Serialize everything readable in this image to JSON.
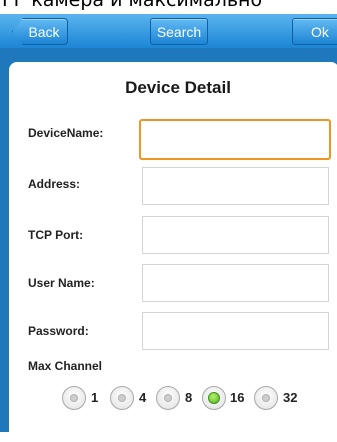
{
  "top_strip_text": "ГГ камера и максимально",
  "navbar": {
    "back_label": "Back",
    "search_label": "Search",
    "ok_label": "Ok"
  },
  "dialog": {
    "title": "Device Detail",
    "fields": [
      {
        "label": "DeviceName:",
        "value": "",
        "focused": true
      },
      {
        "label": "Address:",
        "value": ""
      },
      {
        "label": "TCP Port:",
        "value": ""
      },
      {
        "label": "User Name:",
        "value": ""
      },
      {
        "label": "Password:",
        "value": ""
      }
    ],
    "max_channel_label": "Max Channel",
    "channel_options": [
      {
        "label": "1",
        "selected": false
      },
      {
        "label": "4",
        "selected": false
      },
      {
        "label": "8",
        "selected": false
      },
      {
        "label": "16",
        "selected": true
      },
      {
        "label": "32",
        "selected": false
      }
    ]
  },
  "colors": {
    "nav_blue": "#1c86d6",
    "frame_blue": "#1f78bc",
    "focus_orange": "#f29421",
    "radio_selected": "#53b021"
  }
}
